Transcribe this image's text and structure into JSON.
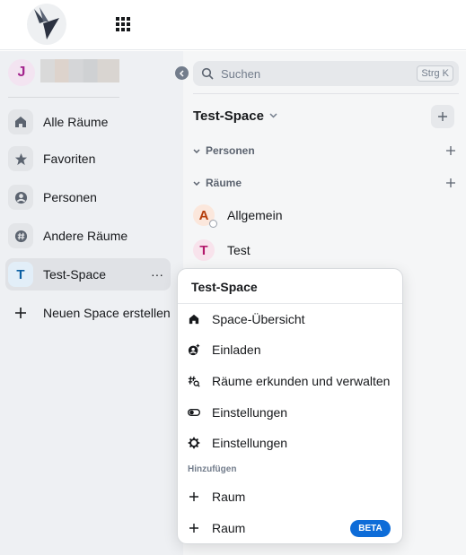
{
  "header": {
    "logo": "hummingbird-logo",
    "apps_icon": "apps-grid-icon"
  },
  "user": {
    "avatar_letter": "J"
  },
  "spacebar": {
    "items": [
      {
        "label": "Alle Räume",
        "icon": "home-icon"
      },
      {
        "label": "Favoriten",
        "icon": "star-icon"
      },
      {
        "label": "Personen",
        "icon": "person-icon"
      },
      {
        "label": "Andere Räume",
        "icon": "hash-icon"
      },
      {
        "label": "Test-Space",
        "icon_letter": "T",
        "more": "···"
      },
      {
        "label": "Neuen Space erstellen",
        "icon": "plus-icon"
      }
    ]
  },
  "roomlist": {
    "search_placeholder": "Suchen",
    "shortcut": "Strg K",
    "space_name": "Test-Space",
    "sections": [
      {
        "label": "Personen"
      },
      {
        "label": "Räume"
      }
    ],
    "rooms": [
      {
        "name": "Allgemein",
        "letter": "A"
      },
      {
        "name": "Test",
        "letter": "T"
      }
    ]
  },
  "context_menu": {
    "title": "Test-Space",
    "items": [
      {
        "label": "Space-Übersicht",
        "icon": "home-icon"
      },
      {
        "label": "Einladen",
        "icon": "invite-icon"
      },
      {
        "label": "Räume erkunden und verwalten",
        "icon": "explore-rooms-icon"
      },
      {
        "label": "Einstellungen",
        "icon": "toggle-icon"
      },
      {
        "label": "Einstellungen",
        "icon": "gear-icon"
      }
    ],
    "add_caption": "Hinzufügen",
    "add_items": [
      {
        "label": "Raum",
        "icon": "plus-icon"
      },
      {
        "label": "Raum",
        "icon": "plus-icon",
        "badge": "BETA"
      }
    ]
  },
  "colors": {
    "accent": "#0d6cd8",
    "space_bg": "#eef0f3",
    "roomlist_bg": "#f5f6f7"
  }
}
